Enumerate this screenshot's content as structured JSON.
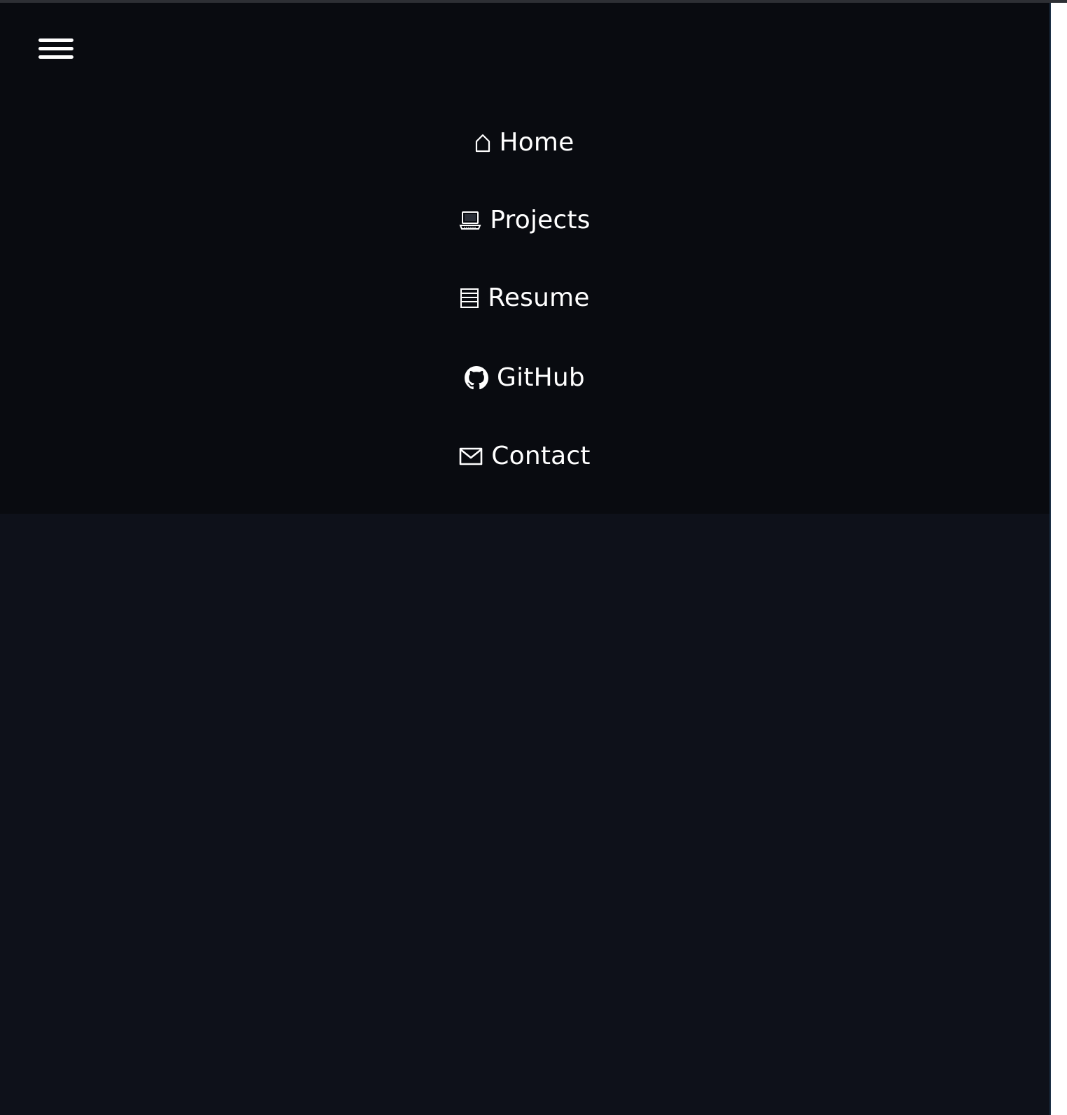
{
  "menu": {
    "toggle_icon": "hamburger-menu-icon"
  },
  "nav": {
    "items": [
      {
        "label": "Home",
        "icon": "home-icon"
      },
      {
        "label": "Projects",
        "icon": "laptop-icon"
      },
      {
        "label": "Resume",
        "icon": "document-icon"
      },
      {
        "label": "GitHub",
        "icon": "github-icon"
      },
      {
        "label": "Contact",
        "icon": "mail-icon"
      }
    ]
  },
  "colors": {
    "nav_background": "#090b10",
    "page_background": "#0e111a",
    "text": "#ffffff"
  }
}
